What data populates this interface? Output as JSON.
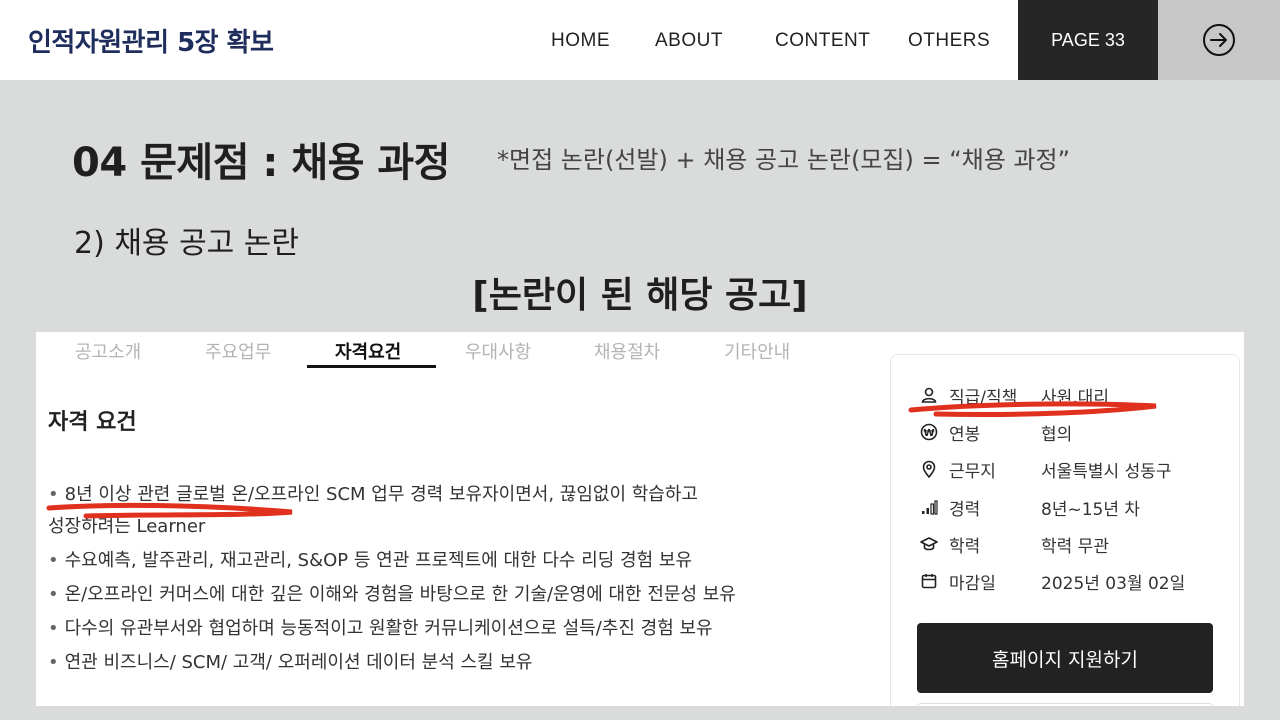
{
  "header": {
    "site_title": "인적자원관리 5장 확보",
    "nav": [
      "HOME",
      "ABOUT",
      "CONTENT",
      "OTHERS"
    ],
    "page_label": "PAGE 33"
  },
  "slide": {
    "heading": "04 문제점 : 채용 과정",
    "heading_note": "*면접 논란(선발) + 채용 공고 논란(모집) = “채용 과정”",
    "subheading": "2) 채용 공고 논란",
    "caption": "[논란이 된 해당 공고]"
  },
  "posting": {
    "tabs": [
      "공고소개",
      "주요업무",
      "자격요건",
      "우대사항",
      "채용절차",
      "기타안내"
    ],
    "active_tab": "자격요건",
    "section_title": "자격 요건",
    "requirements": [
      "8년 이상 관련 글로벌 온/오프라인 SCM 업무 경력 보유자이면서, 끊임없이 학습하고",
      "성장하려는 Learner",
      "수요예측, 발주관리, 재고관리, S&OP 등 연관 프로젝트에 대한 다수 리딩 경험 보유",
      "온/오프라인 커머스에 대한 깊은 이해와 경험을 바탕으로 한 기술/운영에 대한 전문성 보유",
      "다수의 유관부서와 협업하며 능동적이고 원활한 커뮤니케이션으로 설득/추진 경험 보유",
      "연관 비즈니스/ SCM/ 고객/ 오퍼레이션 데이터 분석 스킬 보유"
    ],
    "info": [
      {
        "icon": "person-icon",
        "label": "직급/직책",
        "value": "사원,대리"
      },
      {
        "icon": "won-icon",
        "label": "연봉",
        "value": "협의"
      },
      {
        "icon": "location-pin-icon",
        "label": "근무지",
        "value": "서울특별시 성동구"
      },
      {
        "icon": "bar-chart-icon",
        "label": "경력",
        "value": "8년~15년 차"
      },
      {
        "icon": "graduation-cap-icon",
        "label": "학력",
        "value": "학력 무관"
      },
      {
        "icon": "calendar-icon",
        "label": "마감일",
        "value": "2025년 03월 02일"
      }
    ],
    "apply_button": "홈페이지 지원하기"
  },
  "colors": {
    "accent_title": "#1f2d5c",
    "highlight_marker": "#e0301e",
    "page_box": "#262626",
    "background": "#d9dcdb"
  }
}
